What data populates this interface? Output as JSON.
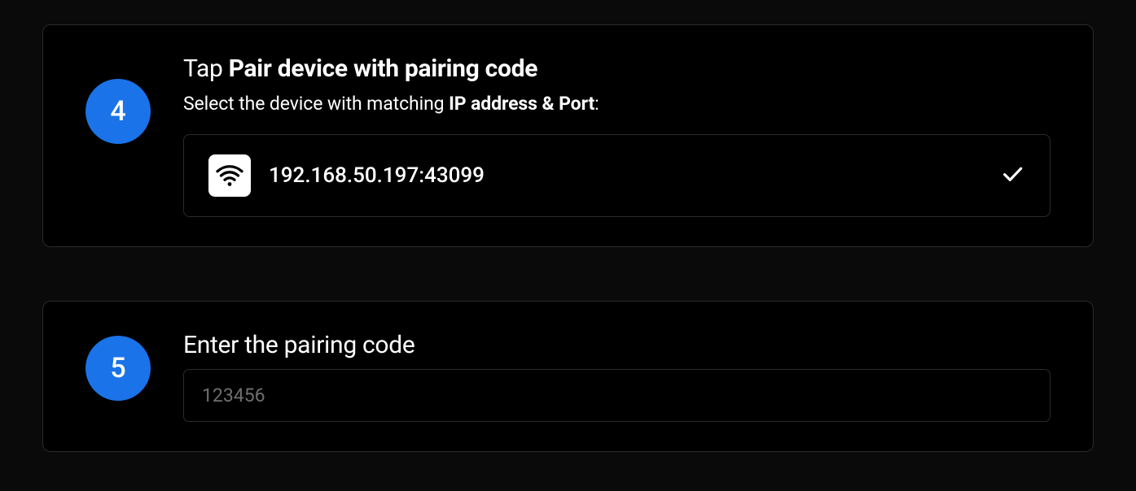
{
  "steps": {
    "step4": {
      "number": "4",
      "heading_prefix": "Tap ",
      "heading_bold": "Pair device with pairing code",
      "sub_prefix": "Select the device with matching ",
      "sub_bold": "IP address & Port",
      "sub_suffix": ":",
      "device_ip": "192.168.50.197:43099"
    },
    "step5": {
      "number": "5",
      "heading": "Enter the pairing code",
      "placeholder": "123456"
    }
  }
}
